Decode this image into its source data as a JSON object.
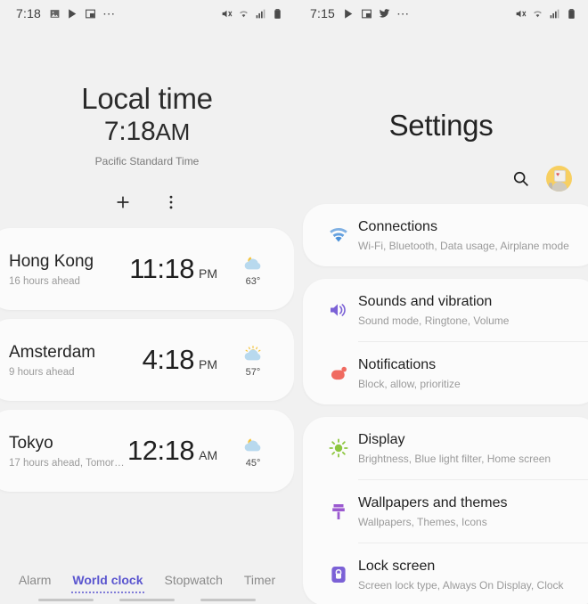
{
  "clock_pane": {
    "status_bar": {
      "time": "7:18",
      "left_icons": [
        "image-icon",
        "play-store-icon",
        "picture-in-picture-icon",
        "more-icons"
      ],
      "right_icons": [
        "mute-icon",
        "wifi-icon",
        "signal-icon",
        "battery-icon"
      ]
    },
    "header": {
      "label": "Local time",
      "time": "7:18",
      "meridiem": "AM",
      "timezone": "Pacific Standard Time"
    },
    "actions": {
      "add_label": "+",
      "more_label": "More options"
    },
    "cities": [
      {
        "name": "Hong Kong",
        "offset": "16 hours ahead",
        "time": "11:18",
        "meridiem": "PM",
        "temp": "63°",
        "weather": "moon-cloud-icon"
      },
      {
        "name": "Amsterdam",
        "offset": "9 hours ahead",
        "time": "4:18",
        "meridiem": "PM",
        "temp": "57°",
        "weather": "sun-cloud-icon"
      },
      {
        "name": "Tokyo",
        "offset": "17 hours ahead, Tomorr…",
        "time": "12:18",
        "meridiem": "AM",
        "temp": "45°",
        "weather": "moon-cloud-icon"
      }
    ],
    "tabs": [
      {
        "label": "Alarm",
        "active": false
      },
      {
        "label": "World clock",
        "active": true
      },
      {
        "label": "Stopwatch",
        "active": false
      },
      {
        "label": "Timer",
        "active": false
      }
    ],
    "accent_color": "#5a55cf"
  },
  "settings_pane": {
    "status_bar": {
      "time": "7:15",
      "left_icons": [
        "play-store-icon",
        "picture-in-picture-icon",
        "twitter-icon",
        "more-icons"
      ],
      "right_icons": [
        "mute-icon",
        "wifi-icon",
        "signal-icon",
        "battery-icon"
      ]
    },
    "title": "Settings",
    "search_label": "Search",
    "avatar_label": "Profile",
    "groups": [
      {
        "rows": [
          {
            "title": "Connections",
            "subtitle": "Wi-Fi, Bluetooth, Data usage, Airplane mode",
            "icon": "wifi-icon",
            "icon_color": "#4a90d9"
          }
        ]
      },
      {
        "rows": [
          {
            "title": "Sounds and vibration",
            "subtitle": "Sound mode, Ringtone, Volume",
            "icon": "speaker-icon",
            "icon_color": "#7b61d6"
          },
          {
            "title": "Notifications",
            "subtitle": "Block, allow, prioritize",
            "icon": "notification-bubble-icon",
            "icon_color": "#f06a60"
          }
        ]
      },
      {
        "rows": [
          {
            "title": "Display",
            "subtitle": "Brightness, Blue light filter, Home screen",
            "icon": "sun-icon",
            "icon_color": "#8dc63f"
          },
          {
            "title": "Wallpapers and themes",
            "subtitle": "Wallpapers, Themes, Icons",
            "icon": "paintbrush-icon",
            "icon_color": "#9b59d0"
          },
          {
            "title": "Lock screen",
            "subtitle": "Screen lock type, Always On Display, Clock",
            "icon": "lock-icon",
            "icon_color": "#7b61d6"
          }
        ]
      }
    ]
  },
  "colors": {
    "background": "#f1f1f1",
    "card": "#fbfbfb",
    "text_primary": "#1f1f1f",
    "text_secondary": "#9a9a9a"
  }
}
